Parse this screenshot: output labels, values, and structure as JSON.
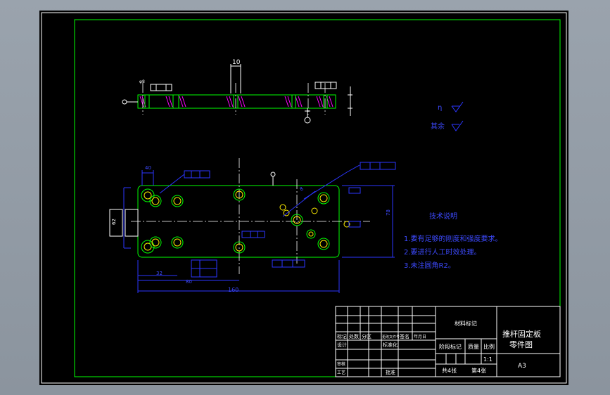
{
  "drawing": {
    "dim_top_10": "10",
    "dim_top_phi": "φ8",
    "dim_w_160": "160",
    "dim_w_80": "80",
    "dim_w_32": "32",
    "dim_h_40": "40",
    "dim_h_62": "62",
    "dim_h_78": "78",
    "dim_r_8": "8"
  },
  "tech_notes": {
    "title": "技术说明",
    "items": [
      "1.要有足够的刚度和强度要求。",
      "2.要进行人工时效处理。",
      "3.未注圆角R2。"
    ]
  },
  "roughness": {
    "label_1": "η",
    "label_2": "其余"
  },
  "title_block": {
    "material_mark": "材料标记",
    "part_name_1": "推杆固定板",
    "part_name_2": "零件图",
    "stage_mark": "阶段标记",
    "weight": "质量",
    "scale": "比例",
    "scale_value": "1:1",
    "sheets_total": "共4张",
    "sheet_no": "第4张",
    "paper_size": "A3",
    "mark": "标记",
    "count": "处数",
    "zone": "分区",
    "change_doc": "更改文件号",
    "signature": "签名",
    "date": "年月日",
    "design": "设计",
    "standardize": "标准化",
    "review": "审核",
    "process": "工艺",
    "approve": "批准"
  }
}
